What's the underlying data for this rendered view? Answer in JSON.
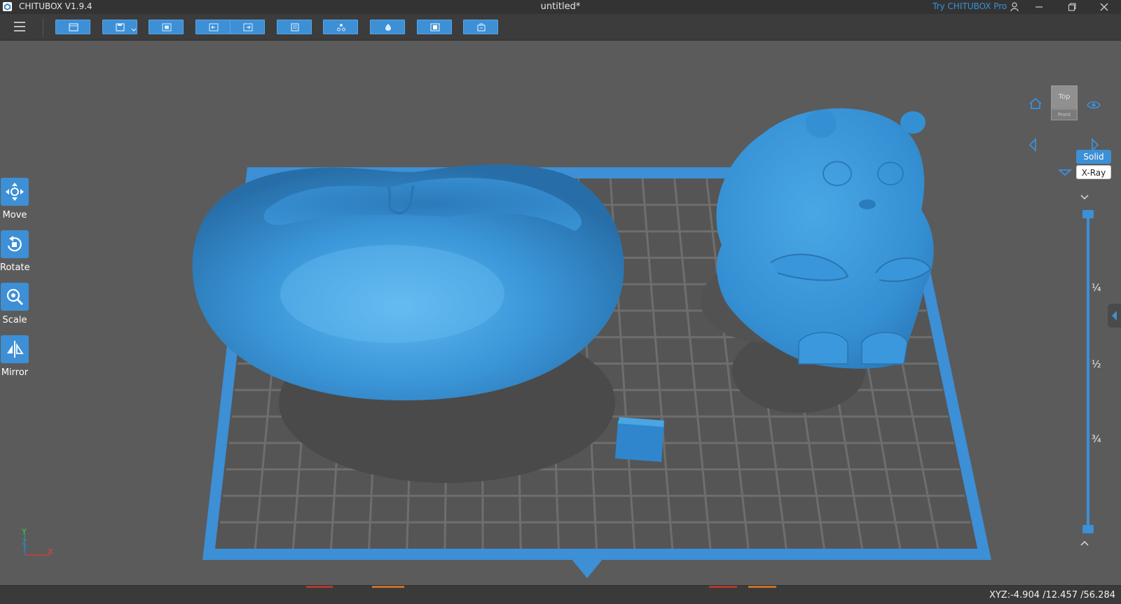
{
  "app": {
    "name": "CHITUBOX V1.9.4",
    "document_title": "untitled*",
    "try_pro": "Try CHITUBOX Pro"
  },
  "colors": {
    "accent": "#3d8fd6",
    "model": "#3a95d8",
    "platform_edge": "#3d8fd6",
    "grid": "#6e6e6e",
    "background": "#5b5b5b"
  },
  "toolbar": {
    "buttons": [
      {
        "icon": "open-file-icon"
      },
      {
        "icon": "save-dropdown-icon"
      },
      {
        "icon": "auto-layout-icon"
      },
      {
        "icon": "undo-icon"
      },
      {
        "icon": "redo-icon"
      },
      {
        "icon": "clear-plate-icon"
      },
      {
        "icon": "support-icon"
      },
      {
        "icon": "hollow-icon"
      },
      {
        "icon": "dig-hole-icon"
      },
      {
        "icon": "slice-icon"
      }
    ]
  },
  "left_tools": [
    {
      "label": "Move",
      "icon": "move-icon"
    },
    {
      "label": "Rotate",
      "icon": "rotate-icon"
    },
    {
      "label": "Scale",
      "icon": "scale-icon"
    },
    {
      "label": "Mirror",
      "icon": "mirror-icon"
    }
  ],
  "view": {
    "cube_top": "Top",
    "cube_front": "Front",
    "render_modes": {
      "solid": "Solid",
      "xray": "X-Ray"
    },
    "slider_marks": [
      "¼",
      "½",
      "¾"
    ],
    "axes": {
      "x": "X",
      "y": "Y",
      "z": "Z"
    }
  },
  "status": {
    "xyz": "XYZ:-4.904 /12.457 /56.284"
  }
}
